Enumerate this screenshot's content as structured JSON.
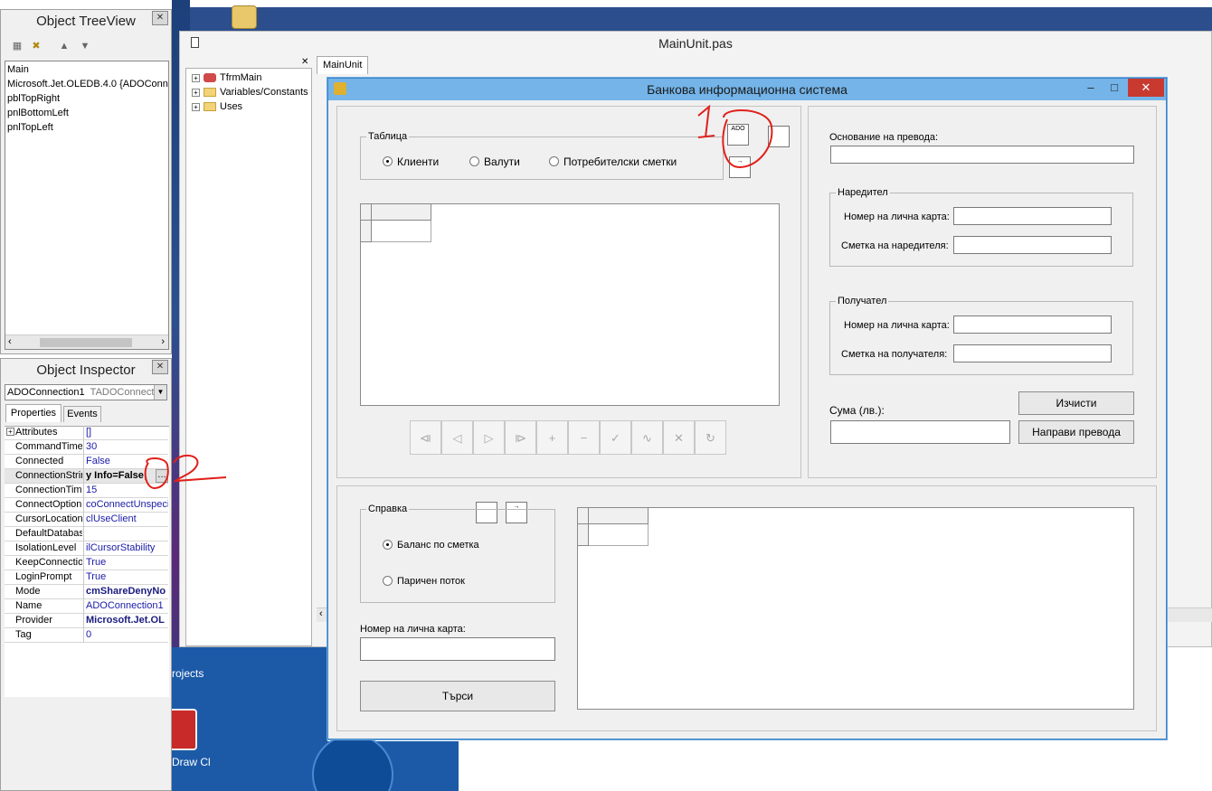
{
  "treeview": {
    "title": "Object TreeView",
    "items": [
      "Main",
      "Microsoft.Jet.OLEDB.4.0 {ADOConne",
      "pblTopRight",
      "pnlBottomLeft",
      "pnlTopLeft"
    ]
  },
  "inspector": {
    "title": "Object Inspector",
    "selected": "ADOConnection1",
    "selected_type": "TADOConnecti",
    "tabs": [
      "Properties",
      "Events"
    ],
    "rows": [
      {
        "name": "Attributes",
        "value": "[]"
      },
      {
        "name": "CommandTimec",
        "value": "30"
      },
      {
        "name": "Connected",
        "value": "False"
      },
      {
        "name": "ConnectionStrin",
        "value": "y Info=False;"
      },
      {
        "name": "ConnectionTime",
        "value": "15"
      },
      {
        "name": "ConnectOption",
        "value": "coConnectUnspecif"
      },
      {
        "name": "CursorLocation",
        "value": "clUseClient"
      },
      {
        "name": "DefaultDatabas",
        "value": ""
      },
      {
        "name": "IsolationLevel",
        "value": "ilCursorStability"
      },
      {
        "name": "KeepConnectio",
        "value": "True"
      },
      {
        "name": "LoginPrompt",
        "value": "True"
      },
      {
        "name": "Mode",
        "value": "cmShareDenyNo"
      },
      {
        "name": "Name",
        "value": "ADOConnection1"
      },
      {
        "name": "Provider",
        "value": "Microsoft.Jet.OL"
      },
      {
        "name": "Tag",
        "value": "0"
      }
    ],
    "ellipsis": "…"
  },
  "editor": {
    "title": "MainUnit.pas",
    "tab": "MainUnit",
    "structure": [
      "TfrmMain",
      "Variables/Constants",
      "Uses"
    ]
  },
  "desktop": {
    "labels": [
      "rojects",
      "Draw Cl"
    ]
  },
  "form": {
    "title": "Банкова информационна система",
    "table_group": "Таблица",
    "table_radios": [
      "Клиенти",
      "Валути",
      "Потребителски сметки"
    ],
    "transfer_reason_label": "Основание на превода:",
    "sender_group": "Наредител",
    "sender_id_label": "Номер на лична карта:",
    "sender_account_label": "Сметка на наредителя:",
    "receiver_group": "Получател",
    "receiver_id_label": "Номер на лична карта:",
    "receiver_account_label": "Сметка на получателя:",
    "amount_label": "Сума (лв.):",
    "clear_button": "Изчисти",
    "transfer_button": "Направи превода",
    "report_group": "Справка",
    "report_radios": [
      "Баланс по сметка",
      "Паричен поток"
    ],
    "id_label": "Номер на лична карта:",
    "search_button": "Търси",
    "nav_buttons": [
      "⧏",
      "◁",
      "▷",
      "⧐",
      "+",
      "−",
      "✓",
      "∿",
      "✕",
      "↻"
    ],
    "components": {
      "ado": "ADO"
    }
  },
  "annotations": {
    "one": "1",
    "two": "2"
  },
  "colors": {
    "form_title": "#74b4e8",
    "close_btn": "#c83a30",
    "accent_red": "#e0201a"
  }
}
